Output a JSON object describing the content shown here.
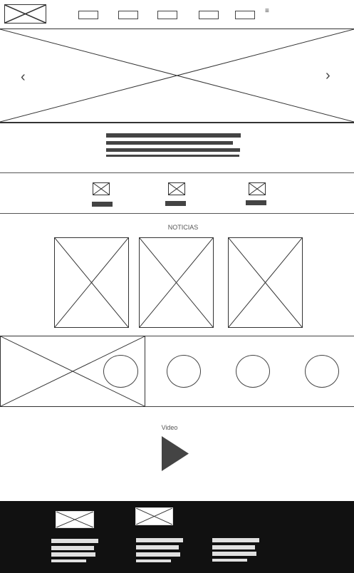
{
  "header": {
    "logo_icon": "image-placeholder-icon",
    "nav_items": [
      "",
      "",
      "",
      "",
      ""
    ],
    "menu_icon": "≡"
  },
  "hero": {
    "image_icon": "image-placeholder-icon",
    "prev_arrow": "‹",
    "next_arrow": "›"
  },
  "intro": {
    "text_lines": 4
  },
  "features": {
    "items": [
      {
        "icon": "envelope-icon"
      },
      {
        "icon": "envelope-icon"
      },
      {
        "icon": "envelope-icon"
      }
    ]
  },
  "news": {
    "title": "NOTICIAS",
    "cards": [
      {
        "image": "image-placeholder-icon"
      },
      {
        "image": "image-placeholder-icon"
      },
      {
        "image": "image-placeholder-icon"
      }
    ]
  },
  "gallery": {
    "image": "image-placeholder-icon",
    "circles": 4
  },
  "video": {
    "title": "Video",
    "play_icon": "play-icon"
  },
  "footer": {
    "logo_icons": [
      "image-placeholder-icon",
      "image-placeholder-icon"
    ],
    "columns": 3
  }
}
